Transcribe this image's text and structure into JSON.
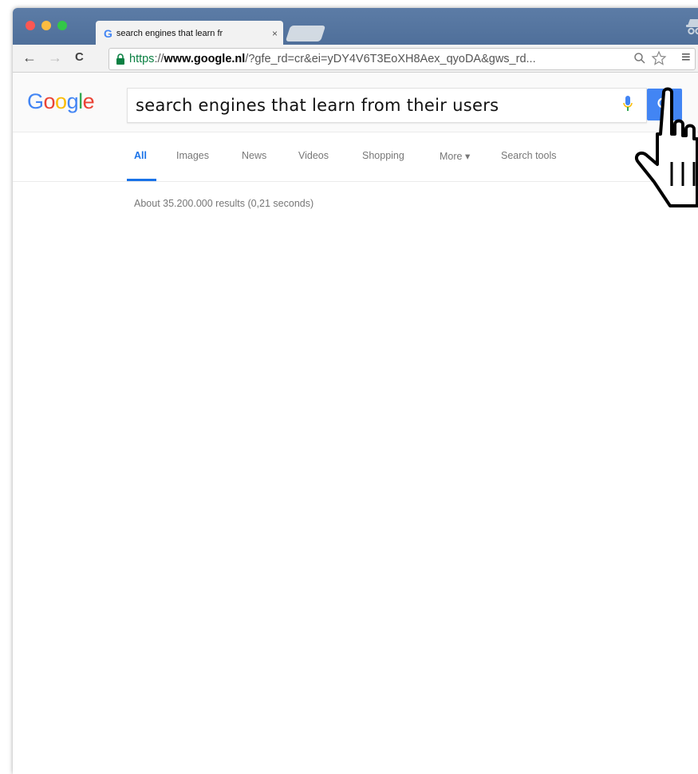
{
  "browser": {
    "tab_title": "search engines that learn fr",
    "tab_close": "×",
    "url_scheme": "https",
    "url_sep": "://",
    "url_domain": "www.google.nl",
    "url_path": "/?gfe_rd=cr&ei=yDY4V6T3EoXH8Aex_qyoDA&gws_rd...",
    "back_icon": "←",
    "forward_icon": "→",
    "reload_icon": "C",
    "menu_icon": "≡"
  },
  "search": {
    "logo": "Google",
    "query": "search engines that learn from their users",
    "tabs": [
      "All",
      "Images",
      "News",
      "Videos",
      "Shopping",
      "More ▾",
      "Search tools"
    ],
    "results_stats": "About 35.200.000 results (0,21 seconds)"
  },
  "colors": {
    "google_blue": "#4285f4",
    "google_red": "#ea4335",
    "google_yellow": "#fbbc05",
    "google_green": "#34a853",
    "titlebar": "#5577a0"
  }
}
